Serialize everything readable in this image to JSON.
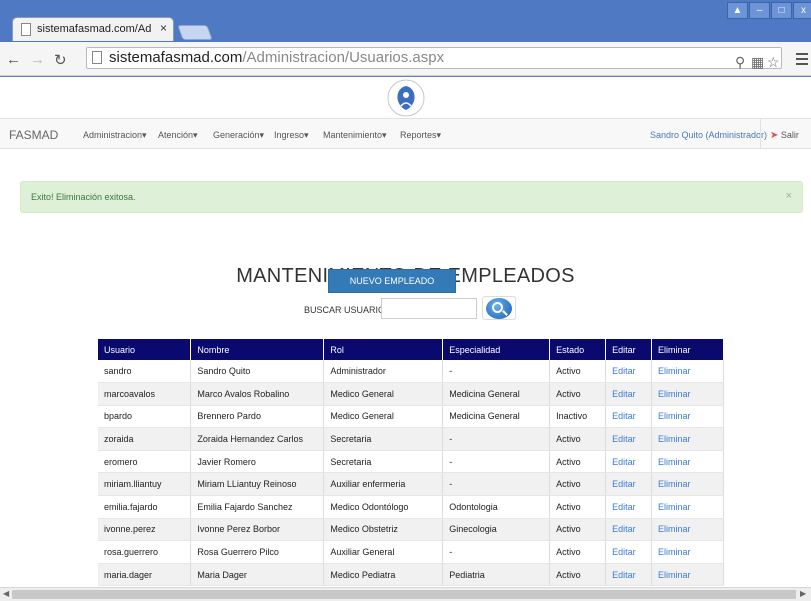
{
  "browser": {
    "tab_title": "sistemafasmad.com/Administ",
    "tab_close": "×",
    "url_host": "sistemafasmad.com",
    "url_path": "/Administracion/Usuarios.aspx",
    "window_buttons": [
      "▲",
      "–",
      "□",
      "x"
    ]
  },
  "navbar": {
    "brand": "FASMAD",
    "items": [
      "Administracion▾",
      "Atención▾",
      "Generación▾",
      "Ingreso▾",
      "Mantenimiento▾",
      "Reportes▾"
    ],
    "user": "Sandro Quito (Administrador)",
    "logout": "Salir"
  },
  "alert": {
    "text": "Exito! Eliminación exitosa.",
    "close": "×"
  },
  "main": {
    "title": "MANTENIMIENTO DE EMPLEADOS",
    "new_button": "NUEVO EMPLEADO",
    "search_label": "BUSCAR USUARIO:",
    "search_value": ""
  },
  "table": {
    "headers": [
      "Usuario",
      "Nombre",
      "Rol",
      "Especialidad",
      "Estado",
      "Editar",
      "Eliminar"
    ],
    "rows": [
      [
        "sandro",
        "Sandro Quito",
        "Administrador",
        "-",
        "Activo",
        "Editar",
        "Eliminar"
      ],
      [
        "marcoavalos",
        "Marco Avalos Robalino",
        "Medico General",
        "Medicina General",
        "Activo",
        "Editar",
        "Eliminar"
      ],
      [
        "bpardo",
        "Brennero Pardo",
        "Medico General",
        "Medicina General",
        "Inactivo",
        "Editar",
        "Eliminar"
      ],
      [
        "zoraida",
        "Zoraida Hernandez Carlos",
        "Secretaria",
        "-",
        "Activo",
        "Editar",
        "Eliminar"
      ],
      [
        "eromero",
        "Javier Romero",
        "Secretaria",
        "-",
        "Activo",
        "Editar",
        "Eliminar"
      ],
      [
        "miriam.lliantuy",
        "Miriam LLiantuy Reinoso",
        "Auxiliar enfermeria",
        "-",
        "Activo",
        "Editar",
        "Eliminar"
      ],
      [
        "emilia.fajardo",
        "Emilia Fajardo Sanchez",
        "Medico Odontólogo",
        "Odontologia",
        "Activo",
        "Editar",
        "Eliminar"
      ],
      [
        "ivonne.perez",
        "Ivonne Perez Borbor",
        "Medico Obstetriz",
        "Ginecologia",
        "Activo",
        "Editar",
        "Eliminar"
      ],
      [
        "rosa.guerrero",
        "Rosa Guerrero Pilco",
        "Auxiliar General",
        "-",
        "Activo",
        "Editar",
        "Eliminar"
      ],
      [
        "maria.dager",
        "Maria Dager",
        "Medico Pediatra",
        "Pediatria",
        "Activo",
        "Editar",
        "Eliminar"
      ]
    ]
  },
  "colors": {
    "table_header": "#0a0a6e",
    "link": "#3a7bd5",
    "primary_button": "#337ab7",
    "alert_bg": "#dff0d8"
  }
}
